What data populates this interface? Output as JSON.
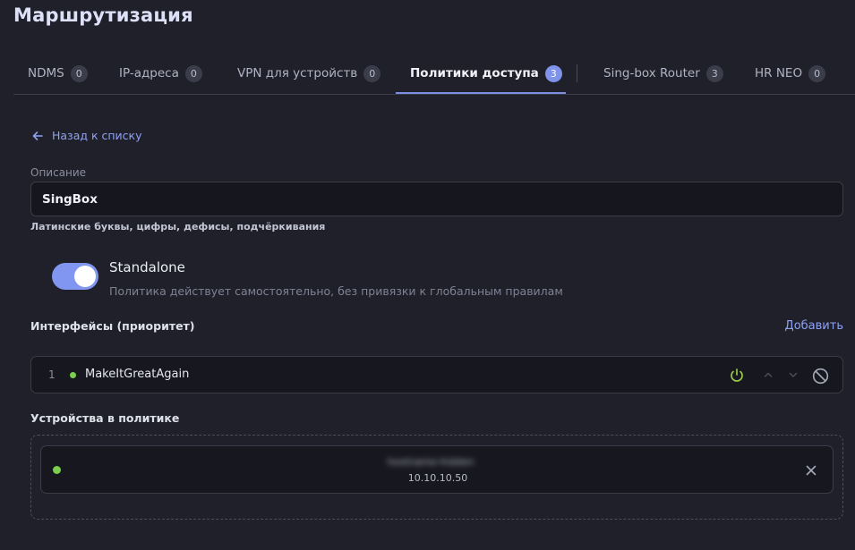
{
  "page": {
    "title": "Маршрутизация"
  },
  "tabs": [
    {
      "label": "NDMS",
      "count": "0"
    },
    {
      "label": "IP-адреса",
      "count": "0"
    },
    {
      "label": "VPN для устройств",
      "count": "0"
    },
    {
      "label": "Политики доступа",
      "count": "3",
      "active": true
    },
    {
      "label": "Sing-box Router",
      "count": "3"
    },
    {
      "label": "HR NEO",
      "count": "0"
    }
  ],
  "back": {
    "label": "Назад к списку",
    "icon": "arrow-left-icon"
  },
  "description": {
    "label": "Описание",
    "value": "SingBox",
    "hint": "Латинские буквы, цифры, дефисы, подчёркивания"
  },
  "standalone": {
    "title": "Standalone",
    "description": "Политика действует самостоятельно, без привязки к глобальным правилам",
    "enabled": true
  },
  "interfaces": {
    "label": "Интерфейсы (приоритет)",
    "add_label": "Добавить",
    "items": [
      {
        "index": "1",
        "name": "MakeItGreatAgain",
        "status_color": "#7ccf4e"
      }
    ]
  },
  "devices": {
    "label": "Устройства в политике",
    "items": [
      {
        "name": "hostname-hidden",
        "ip": "10.10.10.50",
        "status_color": "#7ccf4e"
      }
    ]
  },
  "colors": {
    "accent": "#8196f0",
    "background": "#1f2029",
    "online": "#7ccf4e",
    "power_icon": "#98c94a"
  }
}
